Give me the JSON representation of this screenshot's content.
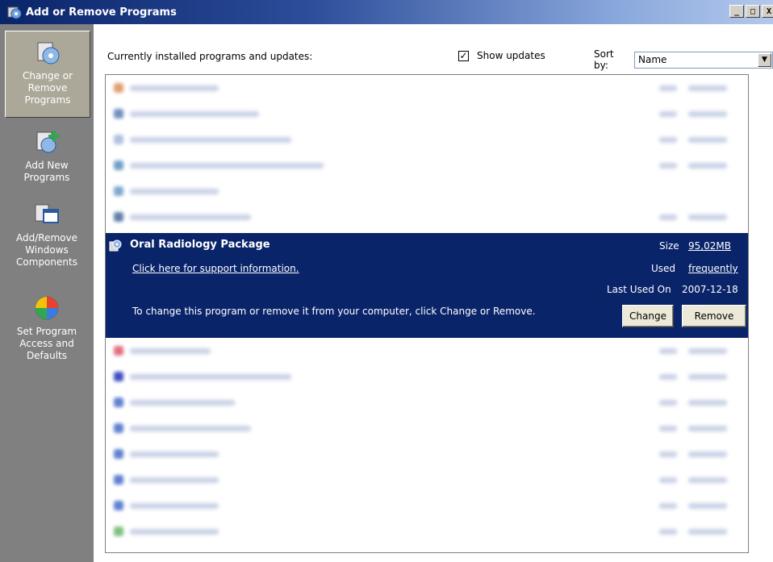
{
  "window": {
    "title": "Add or Remove Programs",
    "buttons": {
      "minimize": "_",
      "maximize": "□",
      "close": "X"
    }
  },
  "sidebar": {
    "items": [
      {
        "label_lines": [
          "Change or",
          "Remove",
          "Programs"
        ],
        "icon": "change-remove-icon",
        "active": true
      },
      {
        "label_lines": [
          "Add New",
          "Programs"
        ],
        "icon": "add-new-programs-icon",
        "active": false
      },
      {
        "label_lines": [
          "Add/Remove",
          "Windows",
          "Components"
        ],
        "icon": "windows-components-icon",
        "active": false
      },
      {
        "label_lines": [
          "Set Program",
          "Access and",
          "Defaults"
        ],
        "icon": "set-program-access-icon",
        "active": false
      }
    ]
  },
  "toolbar": {
    "heading": "Currently installed programs and updates:",
    "show_updates_label": "Show updates",
    "show_updates_checked": true,
    "checkmark": "✓",
    "sort_by_label": "Sort by:",
    "sort_by_value": "Name",
    "dropdown_arrow": "▼"
  },
  "selected_program": {
    "name": "Oral Radiology Package",
    "support_link": "Click here for support information.",
    "size_label": "Size",
    "size_value": "95,02MB",
    "used_label": "Used",
    "used_value": "frequently",
    "last_used_label": "Last Used On",
    "last_used_value": "2007-12-18",
    "hint": "To change this program or remove it from your computer, click Change or Remove.",
    "change_button": "Change",
    "remove_button": "Remove"
  },
  "scrollbar": {
    "up_arrow": "▲",
    "down_arrow": "▼"
  },
  "colors": {
    "selection": "#0a246a",
    "sidebar": "#808080",
    "titlebar": "#0a246a"
  }
}
